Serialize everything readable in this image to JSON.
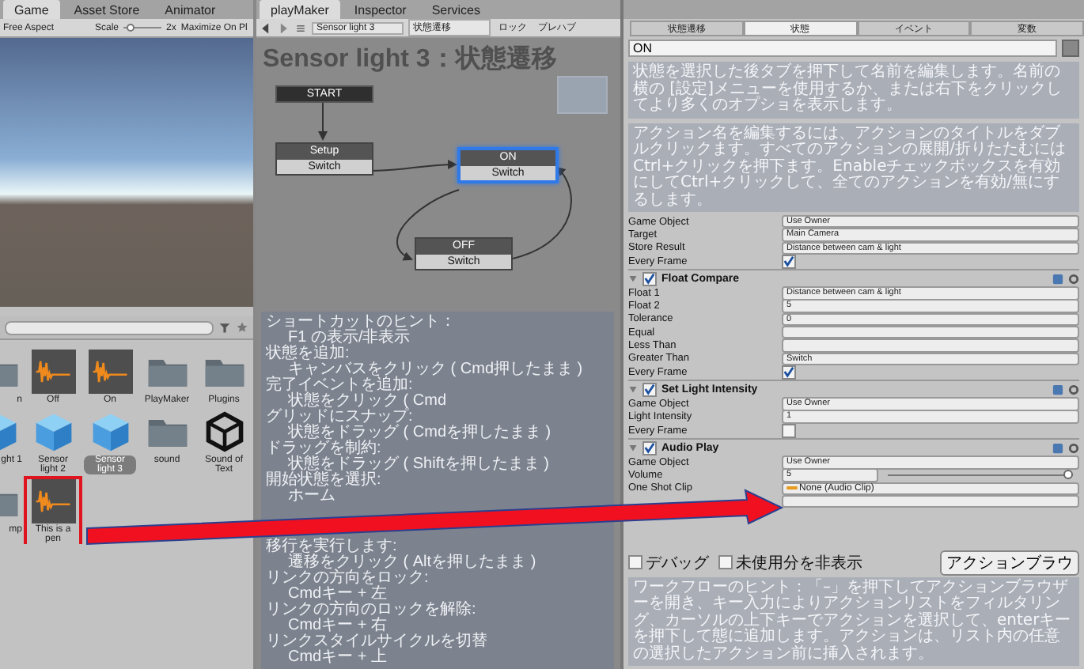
{
  "game_panel": {
    "tabs": [
      {
        "label": "Game",
        "selected": true
      },
      {
        "label": "Asset Store",
        "selected": false
      },
      {
        "label": "Animator",
        "selected": false
      }
    ],
    "aspect": "Free Aspect",
    "scale_label": "Scale",
    "scale": {
      "level": 0.1
    },
    "scale_value": "2x",
    "maximize": "Maximize On Pl"
  },
  "project_panel": {
    "assets": [
      {
        "name": "n",
        "kind": "folder",
        "selected": false,
        "marked": false
      },
      {
        "name": "Off",
        "kind": "audio",
        "selected": false,
        "marked": false
      },
      {
        "name": "On",
        "kind": "audio",
        "selected": false,
        "marked": false
      },
      {
        "name": "PlayMaker",
        "kind": "folder",
        "selected": false,
        "marked": false
      },
      {
        "name": "Plugins",
        "kind": "folder",
        "selected": false,
        "marked": false
      },
      {
        "name": "ght 1",
        "kind": "cube",
        "selected": false,
        "marked": false
      },
      {
        "name": "Sensor light 2",
        "kind": "cube",
        "selected": false,
        "marked": false
      },
      {
        "name": "Sensor light 3",
        "kind": "cube",
        "selected": true,
        "marked": false
      },
      {
        "name": "sound",
        "kind": "folder",
        "selected": false,
        "marked": false
      },
      {
        "name": "Sound of Text",
        "kind": "logo",
        "selected": false,
        "marked": false
      },
      {
        "name": "mp",
        "kind": "folder",
        "selected": false,
        "marked": false
      },
      {
        "name": "This is a pen",
        "kind": "audio",
        "selected": false,
        "marked": true
      }
    ]
  },
  "playmaker": {
    "tabs": [
      {
        "label": "playMaker",
        "selected": true
      },
      {
        "label": "Inspector",
        "selected": false
      },
      {
        "label": "Services",
        "selected": false
      }
    ],
    "fsm_owner": "Sensor light 3",
    "fsm_name": "状態遷移",
    "lock": "ロック",
    "prefab": "プレハブ",
    "graph_title": "Sensor light 3：状態遷移",
    "nodes": [
      {
        "kind": "start",
        "label": "START"
      },
      {
        "kind": "state",
        "label": "Setup",
        "event": "Switch",
        "selected": false
      },
      {
        "kind": "state",
        "label": "ON",
        "event": "Switch",
        "selected": true
      },
      {
        "kind": "state",
        "label": "OFF",
        "event": "Switch",
        "selected": false
      }
    ],
    "hints": [
      {
        "action": "ショートカットのヒント：",
        "shortcut": "F1 の表示/非表示"
      },
      {
        "action": "状態を追加:",
        "shortcut": "キャンバスをクリック ( Cmd押したまま )"
      },
      {
        "action": "完了イベントを追加:",
        "shortcut": "状態をクリック ( Cmd"
      },
      {
        "action": "グリッドにスナップ:",
        "shortcut": "状態をドラッグ ( Cmdを押したまま )"
      },
      {
        "action": "ドラッグを制約:",
        "shortcut": "状態をドラッグ ( Shiftを押したまま )"
      },
      {
        "action": "開始状態を選択:",
        "shortcut": "ホーム"
      },
      {
        "action": "移行を実行します:",
        "shortcut": "遷移をクリック ( Altを押したまま )"
      },
      {
        "action": "リンクの方向をロック:",
        "shortcut": "Cmdキー + 左"
      },
      {
        "action": "リンクの方向のロックを解除:",
        "shortcut": "Cmdキー + 右"
      },
      {
        "action": "リンクスタイルサイクルを切替",
        "shortcut": "Cmdキー + 上"
      }
    ]
  },
  "inspector": {
    "tabs": [
      {
        "label": "状態遷移",
        "selected": false
      },
      {
        "label": "状態",
        "selected": true
      },
      {
        "label": "イベント",
        "selected": false
      },
      {
        "label": "変数",
        "selected": false
      }
    ],
    "state_name": "ON",
    "state_hint": "状態を選択した後タブを押下して名前を編集します。名前の横の [設定]メニューを使用するか、または右下をクリックしてより多くのオプショを表示します。",
    "action_hint": "アクション名を編集するには、アクションのタイトルをダブルクリックます。すべてのアクションの展開/折りたたむにはCtrl+クリックを押下ます。Enableチェックボックスを有効にしてCtrl+クリックして、全てのアクションを有効/無にするします。",
    "actions": [
      {
        "fields": [
          {
            "label": "Game Object",
            "kind": "dropdown",
            "value": "Use Owner"
          },
          {
            "label": "Target",
            "kind": "dropdown",
            "value": "Main Camera"
          },
          {
            "label": "Store Result",
            "kind": "dropdown",
            "value": "Distance between cam & light"
          },
          {
            "label": "Every Frame",
            "kind": "checkbox",
            "checked": true
          }
        ]
      },
      {
        "title": "Float Compare",
        "enabled": true,
        "fields": [
          {
            "label": "Float 1",
            "kind": "dropdown",
            "value": "Distance between cam & light"
          },
          {
            "label": "Float 2",
            "kind": "text",
            "value": "5"
          },
          {
            "label": "Tolerance",
            "kind": "text",
            "value": "0"
          },
          {
            "label": "Equal",
            "kind": "dropdown"
          },
          {
            "label": "Less Than",
            "kind": "dropdown"
          },
          {
            "label": "Greater Than",
            "kind": "dropdown",
            "value": "Switch"
          },
          {
            "label": "Every Frame",
            "kind": "checkbox",
            "checked": true
          }
        ]
      },
      {
        "title": "Set Light Intensity",
        "enabled": true,
        "fields": [
          {
            "label": "Game Object",
            "kind": "dropdown",
            "value": "Use Owner"
          },
          {
            "label": "Light Intensity",
            "kind": "text",
            "value": "1"
          },
          {
            "label": "Every Frame",
            "kind": "checkbox",
            "checked": false
          }
        ]
      },
      {
        "title": "Audio Play",
        "enabled": true,
        "fields": [
          {
            "label": "Game Object",
            "kind": "dropdown",
            "value": "Use Owner"
          },
          {
            "label": "Volume",
            "kind": "slider",
            "value": "5",
            "level": 1
          },
          {
            "label": "One Shot Clip",
            "kind": "object",
            "value": "None (Audio Clip)"
          },
          {
            "kind": "dropdown"
          }
        ]
      }
    ],
    "options": [
      {
        "label": "デバッグ",
        "checked": false
      },
      {
        "label": "未使用分を非表示",
        "checked": false
      }
    ],
    "browser_button": "アクションブラウ",
    "workflow_hint": "ワークフローのヒント：「–」を押下してアクションブラウザーを開き、キー入力によりアクションリストをフィルタリング、カーソルの上下キーでアクションを選択して、enterキーを押下して態に追加します。アクションは、リスト内の任意の選択したアクション前に挿入されます。"
  }
}
